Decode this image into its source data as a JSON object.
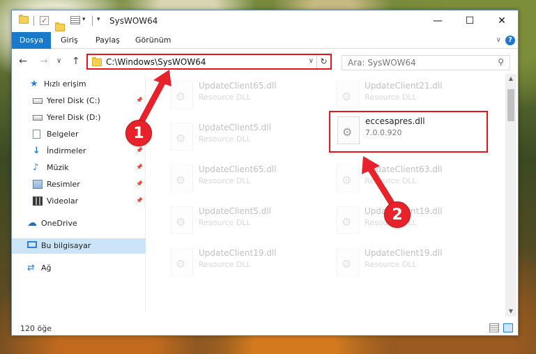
{
  "window": {
    "title": "SysWOW64",
    "controls": {
      "minimize": "—",
      "maximize": "☐",
      "close": "✕"
    }
  },
  "ribbon": {
    "tabs": [
      "Dosya",
      "Giriş",
      "Paylaş",
      "Görünüm"
    ],
    "help": "?"
  },
  "address": {
    "path": "C:\\Windows\\SysWOW64",
    "search_placeholder": "Ara: SysWOW64"
  },
  "nav": {
    "items": [
      {
        "label": "Hızlı erişim",
        "icon": "star-icon",
        "pinned": false,
        "selected": false
      },
      {
        "label": "Yerel Disk (C:)",
        "icon": "drive-icon",
        "pinned": true,
        "selected": false
      },
      {
        "label": "Yerel Disk (D:)",
        "icon": "drive-icon",
        "pinned": false,
        "selected": false
      },
      {
        "label": "Belgeler",
        "icon": "documents-icon",
        "pinned": true,
        "selected": false
      },
      {
        "label": "İndirmeler",
        "icon": "downloads-icon",
        "pinned": true,
        "selected": false
      },
      {
        "label": "Müzik",
        "icon": "music-icon",
        "pinned": true,
        "selected": false
      },
      {
        "label": "Resimler",
        "icon": "pictures-icon",
        "pinned": true,
        "selected": false
      },
      {
        "label": "Videolar",
        "icon": "videos-icon",
        "pinned": true,
        "selected": false
      },
      {
        "label": "OneDrive",
        "icon": "onedrive-icon",
        "pinned": false,
        "selected": false
      },
      {
        "label": "Bu bilgisayar",
        "icon": "this-pc-icon",
        "pinned": false,
        "selected": true
      },
      {
        "label": "Ağ",
        "icon": "network-icon",
        "pinned": false,
        "selected": false
      }
    ]
  },
  "files": [
    {
      "name": "UpdateClient65.dll",
      "sub": "Resource DLL"
    },
    {
      "name": "UpdateClient21.dll",
      "sub": "Resource DLL"
    },
    {
      "name": "UpdateClient5.dll",
      "sub": "Resource DLL"
    },
    {
      "name": "eccesapres.dll",
      "sub": "7.0.0.920"
    },
    {
      "name": "UpdateClient65.dll",
      "sub": "Resource DLL"
    },
    {
      "name": "UpdateClient63.dll",
      "sub": "Resource DLL"
    },
    {
      "name": "UpdateClient5.dll",
      "sub": "Resource DLL"
    },
    {
      "name": "UpdateClient19.dll",
      "sub": "Resource DLL"
    },
    {
      "name": "UpdateClient19.dll",
      "sub": "Resource DLL"
    },
    {
      "name": "UpdateClient19.dll",
      "sub": "Resource DLL"
    }
  ],
  "status": {
    "count": "120 öğe"
  },
  "callouts": [
    "1",
    "2"
  ],
  "colors": {
    "highlight": "#e8131f",
    "accent": "#1979ca",
    "callout": "#e8222b"
  }
}
